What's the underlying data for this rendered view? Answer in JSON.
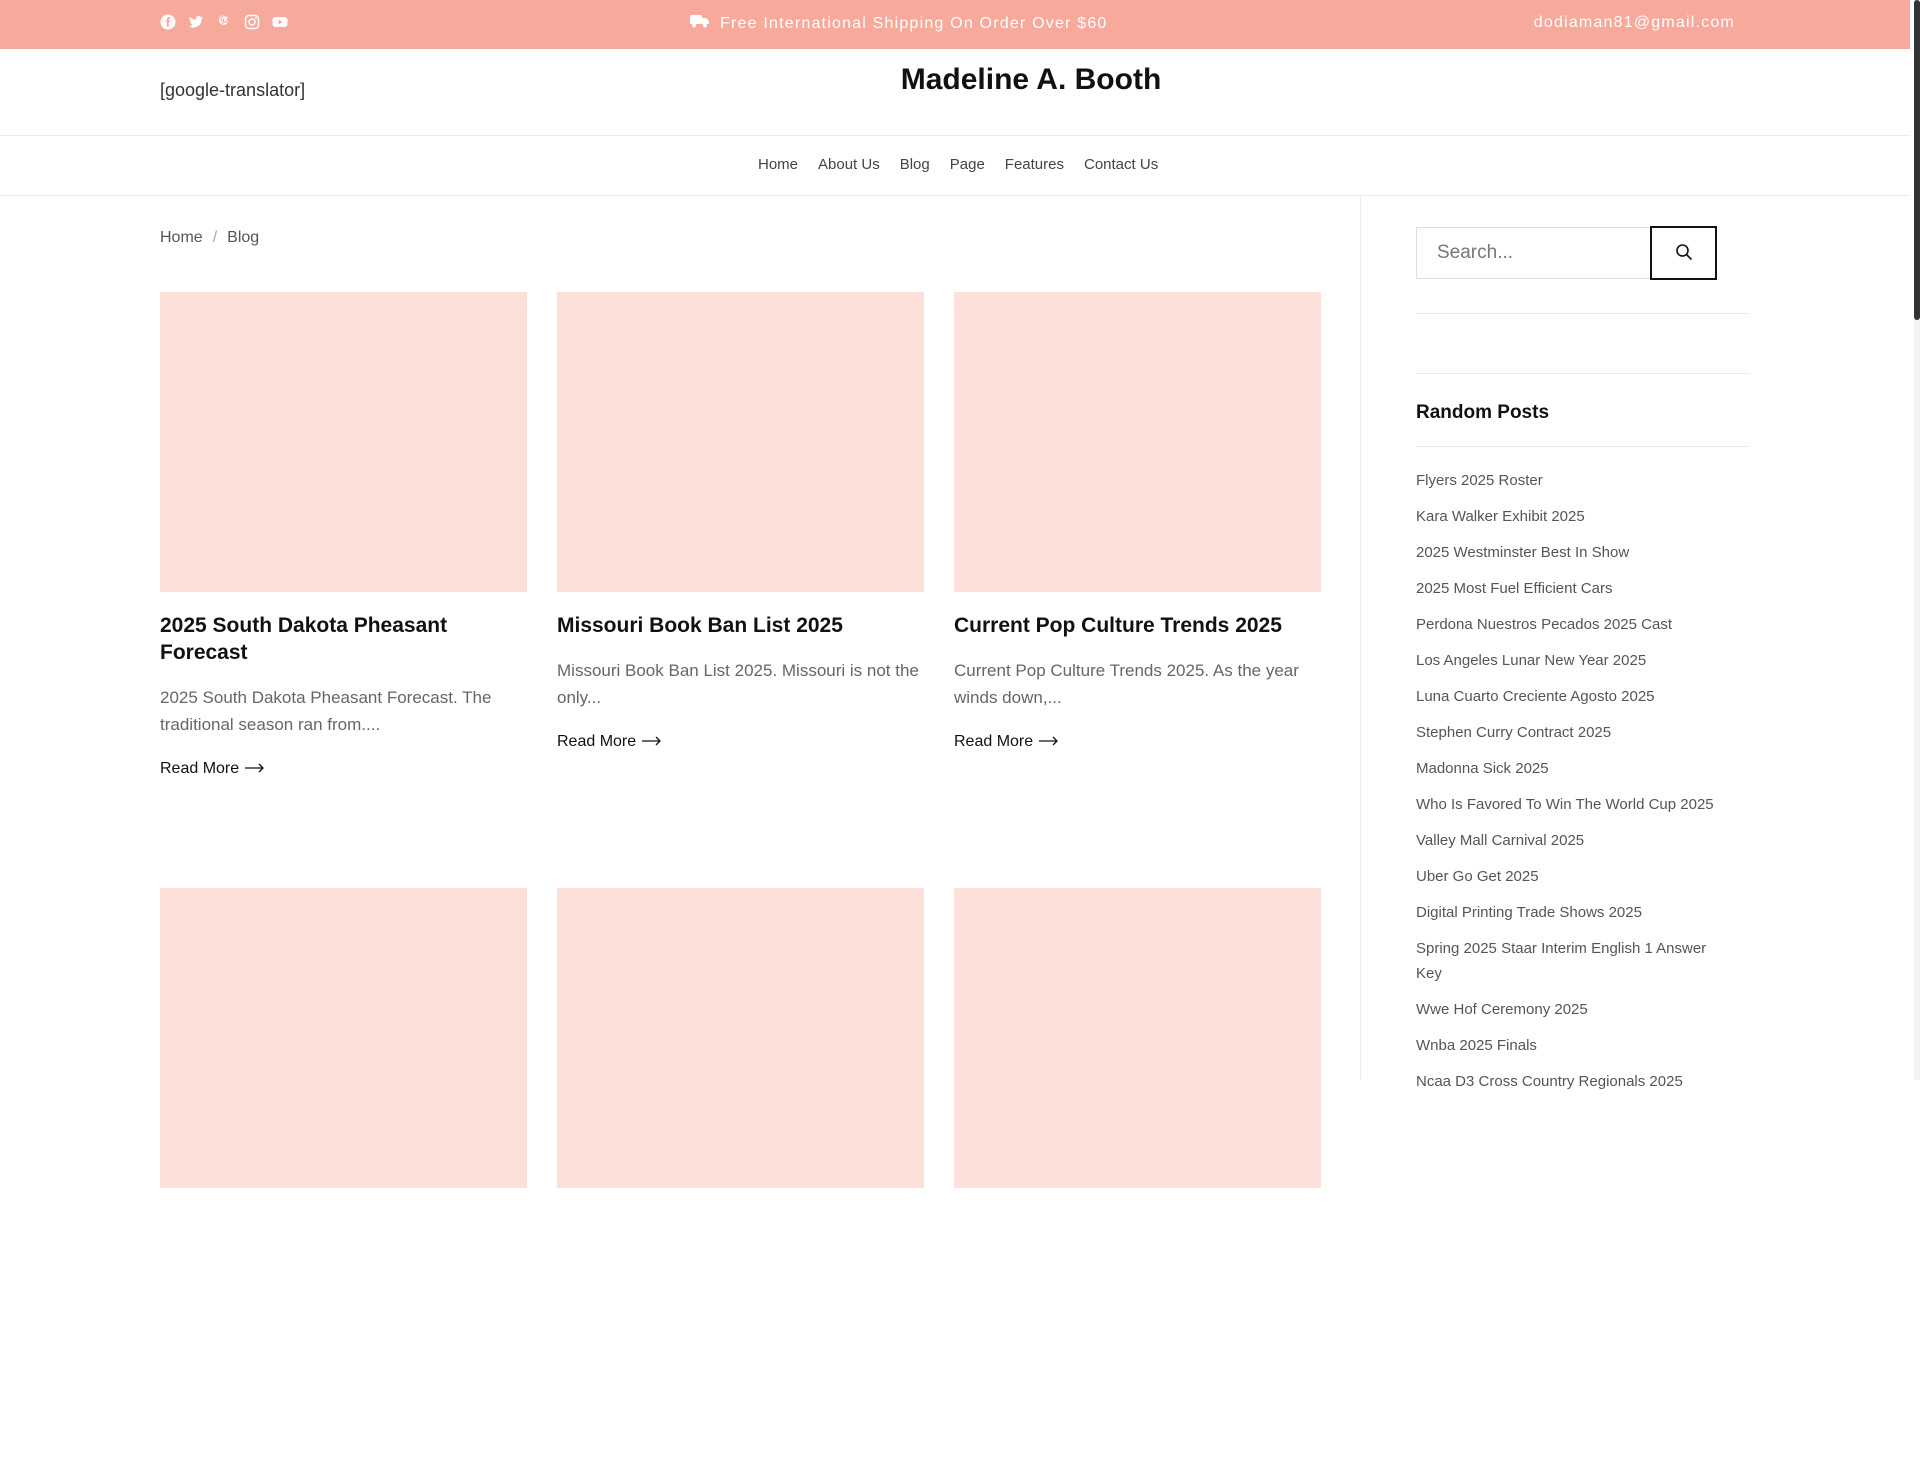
{
  "topbar": {
    "social_icons": [
      "facebook-icon",
      "twitter-icon",
      "pinterest-icon",
      "instagram-icon",
      "youtube-icon"
    ],
    "shipping_text": "Free International Shipping On Order Over $60",
    "email": "dodiaman81@gmail.com",
    "bg_color": "#f7a99b"
  },
  "header": {
    "translator": "[google-translator]",
    "site_title": "Madeline A. Booth"
  },
  "nav": {
    "items": [
      "Home",
      "About Us",
      "Blog",
      "Page",
      "Features",
      "Contact Us"
    ]
  },
  "breadcrumb": {
    "home": "Home",
    "separator": "/",
    "current": "Blog"
  },
  "posts": [
    {
      "title": "2025 South Dakota Pheasant Forecast",
      "excerpt": "2025 South Dakota Pheasant Forecast. The traditional season ran from....",
      "read_more": "Read More"
    },
    {
      "title": "Missouri Book Ban List 2025",
      "excerpt": "Missouri Book Ban List 2025. Missouri is not the only...",
      "read_more": "Read More"
    },
    {
      "title": "Current Pop Culture Trends 2025",
      "excerpt": "Current Pop Culture Trends 2025. As the year winds down,...",
      "read_more": "Read More"
    },
    {
      "title": "",
      "excerpt": "",
      "read_more": ""
    },
    {
      "title": "",
      "excerpt": "",
      "read_more": ""
    },
    {
      "title": "",
      "excerpt": "",
      "read_more": ""
    }
  ],
  "sidebar": {
    "search_placeholder": "Search...",
    "random_posts_title": "Random Posts",
    "random_posts": [
      "Flyers 2025 Roster",
      "Kara Walker Exhibit 2025",
      "2025 Westminster Best In Show",
      "2025 Most Fuel Efficient Cars",
      "Perdona Nuestros Pecados 2025 Cast",
      "Los Angeles Lunar New Year 2025",
      "Luna Cuarto Creciente Agosto 2025",
      "Stephen Curry Contract 2025",
      "Madonna Sick 2025",
      "Who Is Favored To Win The World Cup 2025",
      "Valley Mall Carnival 2025",
      "Uber Go Get 2025",
      "Digital Printing Trade Shows 2025",
      "Spring 2025 Staar Interim English 1 Answer Key",
      "Wwe Hof Ceremony 2025",
      "Wnba 2025 Finals",
      "Ncaa D3 Cross Country Regionals 2025"
    ]
  },
  "colors": {
    "thumb_placeholder": "#fde0da",
    "accent": "#f7a99b"
  }
}
